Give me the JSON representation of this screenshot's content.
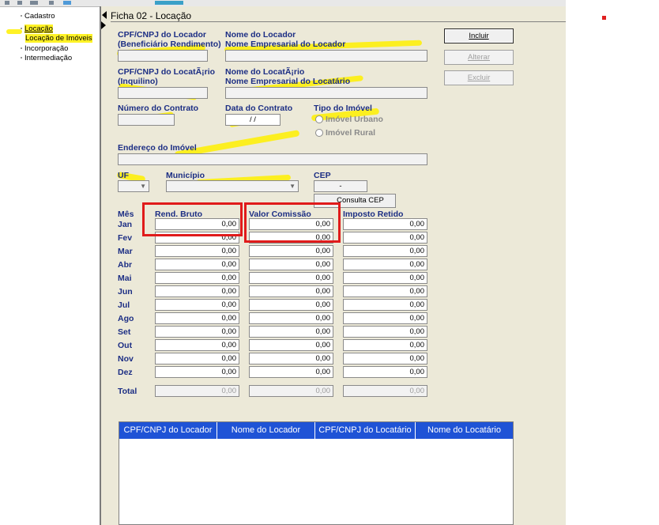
{
  "tree": {
    "items": [
      {
        "label": "Cadastro"
      },
      {
        "label": "Locação"
      },
      {
        "label": "Locação de Imóveis"
      },
      {
        "label": "Incorporação"
      },
      {
        "label": "Intermediação"
      }
    ]
  },
  "panel": {
    "title": "Ficha 02 - Locação"
  },
  "form": {
    "cpf_locador_label_1": "CPF/CNPJ do Locador",
    "cpf_locador_label_2": "(Beneficiário Rendimento)",
    "nome_locador_label_1": "Nome do Locador",
    "nome_locador_label_2": "Nome Empresarial do Locador",
    "cpf_locatario_label_1": "CPF/CNPJ do LocatÃ¡rio",
    "cpf_locatario_label_2": "(Inquilino)",
    "nome_locatario_label_1": "Nome do LocatÃ¡rio",
    "nome_locatario_label_2": "Nome Empresarial do Locatário",
    "numero_contrato_label": "Número do Contrato",
    "data_contrato_label": "Data do Contrato",
    "data_contrato_value": " / /",
    "tipo_imovel_label": "Tipo do Imóvel",
    "imovel_urbano_label": "Imóvel Urbano",
    "imovel_rural_label": "Imóvel Rural",
    "endereco_label": "Endereço do Imóvel",
    "uf_label": "UF",
    "municipio_label": "Município",
    "cep_label": "CEP",
    "cep_value": "-",
    "consulta_cep_label": "Consulta CEP"
  },
  "buttons": {
    "incluir": "Incluir",
    "alterar": "Alterar",
    "excluir": "Excluir"
  },
  "table": {
    "headers": {
      "mes": "Mês",
      "rend_bruto": "Rend. Bruto",
      "valor_comissao": "Valor Comissão",
      "imposto_retido": "Imposto Retido"
    },
    "rows": [
      {
        "month": "Jan",
        "rend": "0,00",
        "comissao": "0,00",
        "imposto": "0,00"
      },
      {
        "month": "Fev",
        "rend": "0,00",
        "comissao": "0,00",
        "imposto": "0,00"
      },
      {
        "month": "Mar",
        "rend": "0,00",
        "comissao": "0,00",
        "imposto": "0,00"
      },
      {
        "month": "Abr",
        "rend": "0,00",
        "comissao": "0,00",
        "imposto": "0,00"
      },
      {
        "month": "Mai",
        "rend": "0,00",
        "comissao": "0,00",
        "imposto": "0,00"
      },
      {
        "month": "Jun",
        "rend": "0,00",
        "comissao": "0,00",
        "imposto": "0,00"
      },
      {
        "month": "Jul",
        "rend": "0,00",
        "comissao": "0,00",
        "imposto": "0,00"
      },
      {
        "month": "Ago",
        "rend": "0,00",
        "comissao": "0,00",
        "imposto": "0,00"
      },
      {
        "month": "Set",
        "rend": "0,00",
        "comissao": "0,00",
        "imposto": "0,00"
      },
      {
        "month": "Out",
        "rend": "0,00",
        "comissao": "0,00",
        "imposto": "0,00"
      },
      {
        "month": "Nov",
        "rend": "0,00",
        "comissao": "0,00",
        "imposto": "0,00"
      },
      {
        "month": "Dez",
        "rend": "0,00",
        "comissao": "0,00",
        "imposto": "0,00"
      }
    ],
    "total": {
      "label": "Total",
      "rend": "0,00",
      "comissao": "0,00",
      "imposto": "0,00"
    }
  },
  "grid": {
    "columns": [
      "CPF/CNPJ do Locador",
      "Nome do Locador",
      "CPF/CNPJ do Locatário",
      "Nome do Locatário"
    ]
  },
  "colors": {
    "label_blue": "#1c2e84",
    "grid_header": "#1f53d6",
    "annotation_red": "#e01b1b",
    "highlight_yellow": "#fff000"
  }
}
